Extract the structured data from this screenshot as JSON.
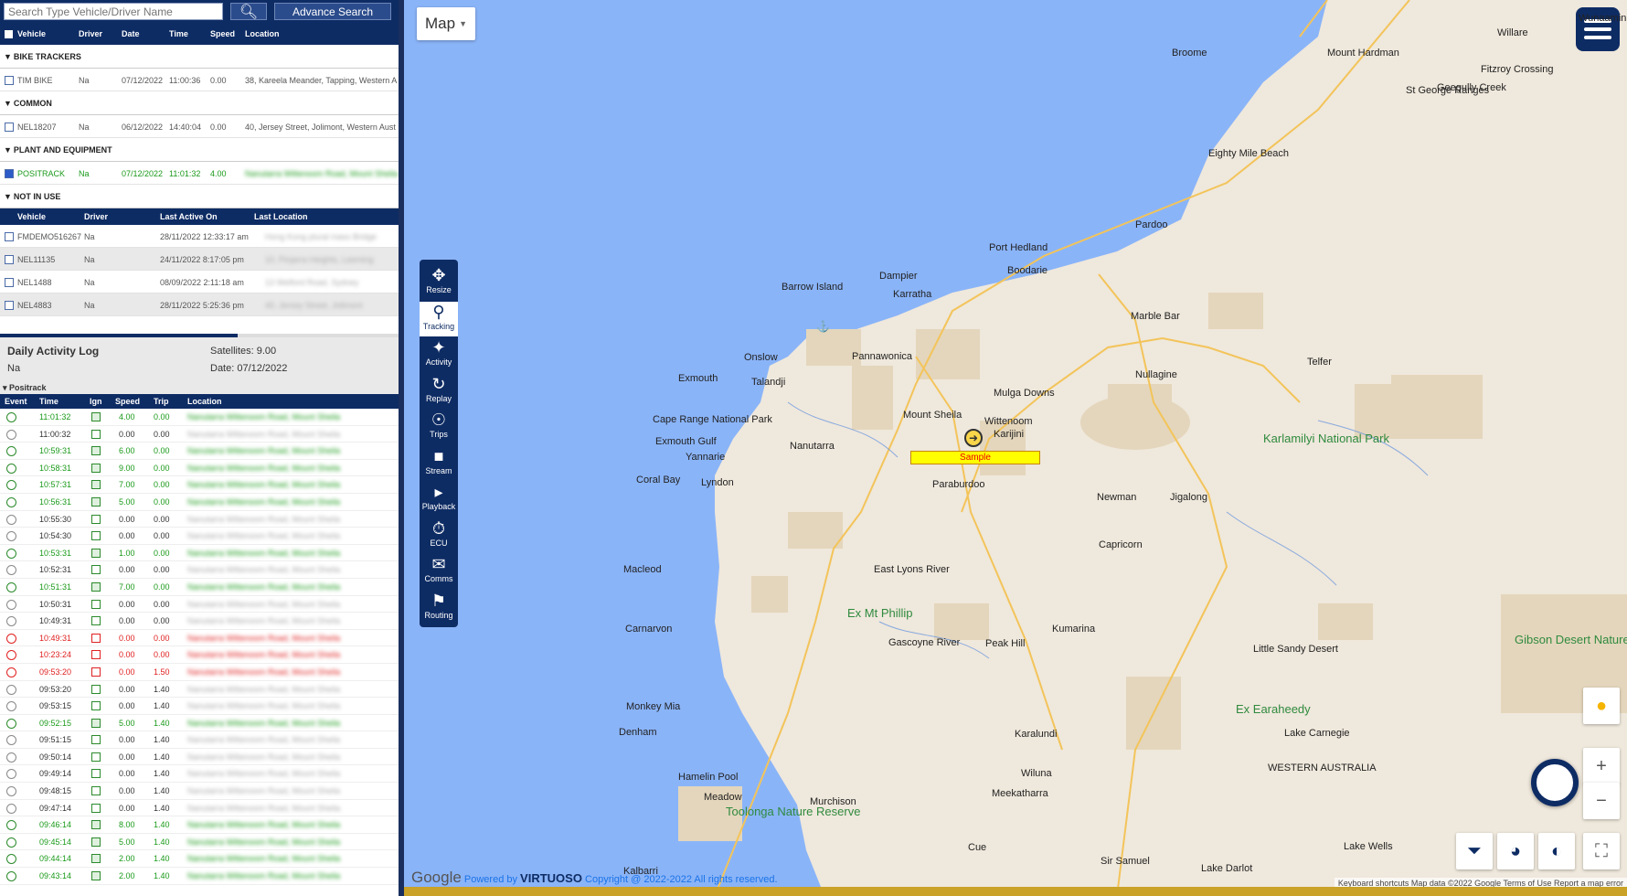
{
  "search": {
    "placeholder": "Search Type Vehicle/Driver Name",
    "advance_label": "Advance Search"
  },
  "vehicle_table": {
    "headers": [
      "Vehicle",
      "Driver",
      "Date",
      "Time",
      "Speed",
      "Location"
    ],
    "groups": [
      {
        "name": "BIKE TRACKERS",
        "rows": [
          {
            "vehicle": "TIM BIKE",
            "driver": "Na",
            "date": "07/12/2022",
            "time": "11:00:36",
            "speed": "0.00",
            "location": "38, Kareela Meander, Tapping, Western A"
          }
        ]
      },
      {
        "name": "COMMON",
        "rows": [
          {
            "vehicle": "NEL18207",
            "driver": "Na",
            "date": "06/12/2022",
            "time": "14:40:04",
            "speed": "0.00",
            "location": "40, Jersey Street, Jolimont, Western Aust"
          }
        ]
      },
      {
        "name": "PLANT AND EQUIPMENT",
        "rows": [
          {
            "vehicle": "POSITRACK",
            "driver": "Na",
            "date": "07/12/2022",
            "time": "11:01:32",
            "speed": "4.00",
            "location": "Nanutarra Wittenoom Road, Mount Sheila"
          }
        ]
      },
      {
        "name": "NOT IN USE",
        "rows": []
      }
    ]
  },
  "not_in_use": {
    "headers": [
      "Vehicle",
      "Driver",
      "Last Active On",
      "Last Location"
    ],
    "rows": [
      {
        "vehicle": "FMDEMO516267",
        "driver": "Na",
        "last": "28/11/2022 12:33:17 am",
        "loc": "Hong Kong plural mass Bridge"
      },
      {
        "vehicle": "NEL11135",
        "driver": "Na",
        "last": "24/11/2022 8:17:05 pm",
        "loc": "10, Pinjarra Heights, Leeming"
      },
      {
        "vehicle": "NEL1488",
        "driver": "Na",
        "last": "08/09/2022 2:11:18 am",
        "loc": "13 Welford Road, Sydney"
      },
      {
        "vehicle": "NEL4883",
        "driver": "Na",
        "last": "28/11/2022 5:25:36 pm",
        "loc": "40, Jersey Street, Jolimont"
      }
    ]
  },
  "activity": {
    "title": "Daily Activity Log",
    "driver": "Na",
    "satellites": "Satellites: 9.00",
    "date": "Date: 07/12/2022",
    "group": "Positrack"
  },
  "log": {
    "headers": [
      "Event",
      "Time",
      "Ign",
      "Speed",
      "Trip",
      "Location"
    ],
    "rows": [
      {
        "time": "11:01:32",
        "speed": "4.00",
        "trip": "0.00",
        "state": "move"
      },
      {
        "time": "11:00:32",
        "speed": "0.00",
        "trip": "0.00",
        "state": "idle"
      },
      {
        "time": "10:59:31",
        "speed": "6.00",
        "trip": "0.00",
        "state": "move"
      },
      {
        "time": "10:58:31",
        "speed": "9.00",
        "trip": "0.00",
        "state": "move"
      },
      {
        "time": "10:57:31",
        "speed": "7.00",
        "trip": "0.00",
        "state": "move"
      },
      {
        "time": "10:56:31",
        "speed": "5.00",
        "trip": "0.00",
        "state": "move"
      },
      {
        "time": "10:55:30",
        "speed": "0.00",
        "trip": "0.00",
        "state": "idle"
      },
      {
        "time": "10:54:30",
        "speed": "0.00",
        "trip": "0.00",
        "state": "idle"
      },
      {
        "time": "10:53:31",
        "speed": "1.00",
        "trip": "0.00",
        "state": "move"
      },
      {
        "time": "10:52:31",
        "speed": "0.00",
        "trip": "0.00",
        "state": "idle"
      },
      {
        "time": "10:51:31",
        "speed": "7.00",
        "trip": "0.00",
        "state": "move"
      },
      {
        "time": "10:50:31",
        "speed": "0.00",
        "trip": "0.00",
        "state": "idle"
      },
      {
        "time": "10:49:31",
        "speed": "0.00",
        "trip": "0.00",
        "state": "idle"
      },
      {
        "time": "10:49:31",
        "speed": "0.00",
        "trip": "0.00",
        "state": "off"
      },
      {
        "time": "10:23:24",
        "speed": "0.00",
        "trip": "0.00",
        "state": "off"
      },
      {
        "time": "09:53:20",
        "speed": "0.00",
        "trip": "1.50",
        "state": "off"
      },
      {
        "time": "09:53:20",
        "speed": "0.00",
        "trip": "1.40",
        "state": "idle"
      },
      {
        "time": "09:53:15",
        "speed": "0.00",
        "trip": "1.40",
        "state": "idle"
      },
      {
        "time": "09:52:15",
        "speed": "5.00",
        "trip": "1.40",
        "state": "move"
      },
      {
        "time": "09:51:15",
        "speed": "0.00",
        "trip": "1.40",
        "state": "idle"
      },
      {
        "time": "09:50:14",
        "speed": "0.00",
        "trip": "1.40",
        "state": "idle"
      },
      {
        "time": "09:49:14",
        "speed": "0.00",
        "trip": "1.40",
        "state": "idle"
      },
      {
        "time": "09:48:15",
        "speed": "0.00",
        "trip": "1.40",
        "state": "idle"
      },
      {
        "time": "09:47:14",
        "speed": "0.00",
        "trip": "1.40",
        "state": "idle"
      },
      {
        "time": "09:46:14",
        "speed": "8.00",
        "trip": "1.40",
        "state": "move"
      },
      {
        "time": "09:45:14",
        "speed": "5.00",
        "trip": "1.40",
        "state": "move"
      },
      {
        "time": "09:44:14",
        "speed": "2.00",
        "trip": "1.40",
        "state": "move"
      },
      {
        "time": "09:43:14",
        "speed": "2.00",
        "trip": "1.40",
        "state": "move"
      }
    ]
  },
  "map": {
    "type_label": "Map",
    "marker_label": "Sample"
  },
  "toolbar": [
    "Resize",
    "Tracking",
    "Activity",
    "Replay",
    "Trips",
    "Stream",
    "Playback",
    "ECU",
    "Comms",
    "Routing"
  ],
  "places": [
    {
      "name": "Broome",
      "cls": ""
    },
    {
      "name": "Eighty Mile Beach",
      "cls": ""
    },
    {
      "name": "Pardoo",
      "cls": ""
    },
    {
      "name": "Port Hedland",
      "cls": ""
    },
    {
      "name": "Boodarie",
      "cls": ""
    },
    {
      "name": "Dampier",
      "cls": ""
    },
    {
      "name": "Karratha",
      "cls": ""
    },
    {
      "name": "Barrow Island",
      "cls": ""
    },
    {
      "name": "Marble Bar",
      "cls": ""
    },
    {
      "name": "Onslow",
      "cls": ""
    },
    {
      "name": "Pannawonica",
      "cls": ""
    },
    {
      "name": "Nullagine",
      "cls": ""
    },
    {
      "name": "Telfer",
      "cls": ""
    },
    {
      "name": "Exmouth",
      "cls": ""
    },
    {
      "name": "Talandji",
      "cls": ""
    },
    {
      "name": "Mulga Downs",
      "cls": ""
    },
    {
      "name": "Mount Sheila",
      "cls": ""
    },
    {
      "name": "Wittenoom",
      "cls": ""
    },
    {
      "name": "Karijini",
      "cls": ""
    },
    {
      "name": "Cape Range National Park",
      "cls": ""
    },
    {
      "name": "Exmouth Gulf",
      "cls": ""
    },
    {
      "name": "Nanutarra",
      "cls": ""
    },
    {
      "name": "Yannarie",
      "cls": ""
    },
    {
      "name": "Karlamilyi National Park",
      "cls": "park"
    },
    {
      "name": "Coral Bay",
      "cls": ""
    },
    {
      "name": "Lyndon",
      "cls": ""
    },
    {
      "name": "Paraburdoo",
      "cls": ""
    },
    {
      "name": "Newman",
      "cls": ""
    },
    {
      "name": "Jigalong",
      "cls": ""
    },
    {
      "name": "Capricorn",
      "cls": ""
    },
    {
      "name": "Macleod",
      "cls": ""
    },
    {
      "name": "East Lyons River",
      "cls": ""
    },
    {
      "name": "Ex Mt Phillip",
      "cls": "park"
    },
    {
      "name": "Carnarvon",
      "cls": ""
    },
    {
      "name": "Kumarina",
      "cls": ""
    },
    {
      "name": "Gascoyne River",
      "cls": ""
    },
    {
      "name": "Peak Hill",
      "cls": ""
    },
    {
      "name": "Little Sandy Desert",
      "cls": ""
    },
    {
      "name": "Gibson Desert Nature Reserve",
      "cls": "park"
    },
    {
      "name": "Monkey Mia",
      "cls": ""
    },
    {
      "name": "Denham",
      "cls": ""
    },
    {
      "name": "Ex Earaheedy",
      "cls": "park"
    },
    {
      "name": "Lake Carnegie",
      "cls": ""
    },
    {
      "name": "Karalundi",
      "cls": ""
    },
    {
      "name": "Hamelin Pool",
      "cls": ""
    },
    {
      "name": "WESTERN AUSTRALIA",
      "cls": ""
    },
    {
      "name": "Meadow",
      "cls": ""
    },
    {
      "name": "Murchison",
      "cls": ""
    },
    {
      "name": "Meekatharra",
      "cls": ""
    },
    {
      "name": "Wiluna",
      "cls": ""
    },
    {
      "name": "Toolonga Nature Reserve",
      "cls": "park"
    },
    {
      "name": "Cue",
      "cls": ""
    },
    {
      "name": "Lake Wells",
      "cls": ""
    },
    {
      "name": "Kalbarri",
      "cls": ""
    },
    {
      "name": "Sir Samuel",
      "cls": ""
    },
    {
      "name": "Lake Darlot",
      "cls": ""
    },
    {
      "name": "Mount Hardman",
      "cls": ""
    },
    {
      "name": "Geegully Creek",
      "cls": ""
    },
    {
      "name": "St George Ranges",
      "cls": ""
    },
    {
      "name": "Fitzroy Crossing",
      "cls": ""
    },
    {
      "name": "Willare",
      "cls": ""
    },
    {
      "name": "Wunaamin Miliwundi Ranges",
      "cls": ""
    }
  ],
  "footer": {
    "google": "Google",
    "powered": "Powered by",
    "brand": "VIRTUOSO",
    "copyright": "Copyright @ 2022-2022 All rights reserved.",
    "mapdata": "Keyboard shortcuts   Map data ©2022 Google   Terms of Use   Report a map error"
  }
}
